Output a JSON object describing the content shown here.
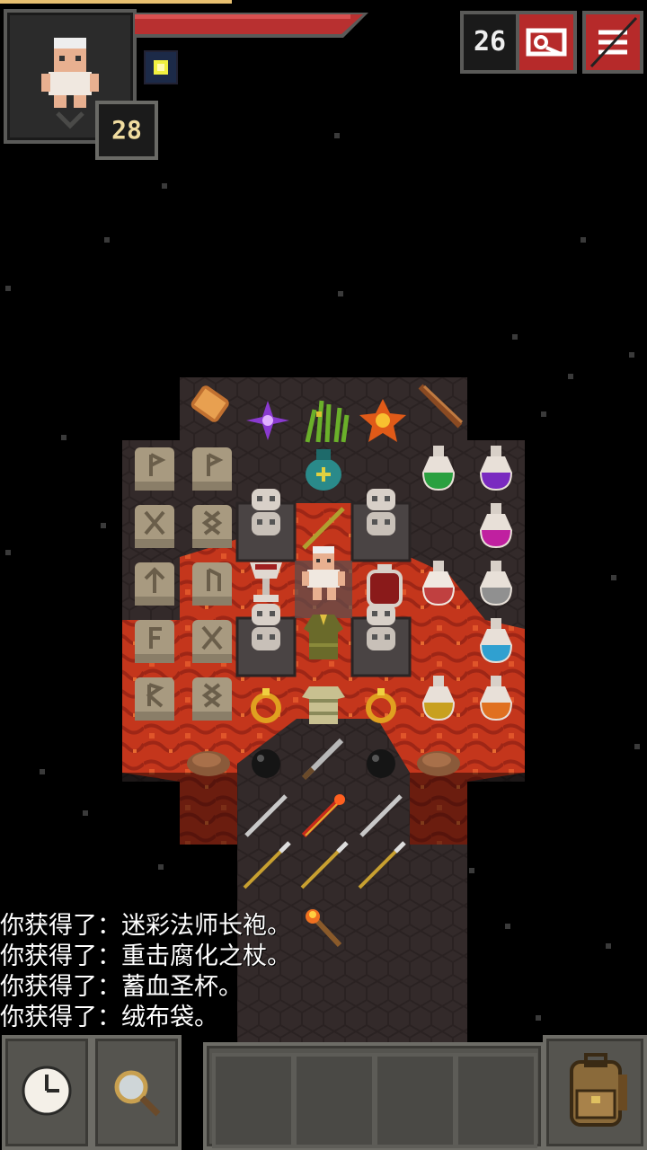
{
  "hud": {
    "hero_level": "28",
    "depth": "26",
    "journal_icon": "journal-icon",
    "menu_icon": "menu-icon"
  },
  "log": [
    "你获得了：迷彩法师长袍。",
    "你获得了：重击腐化之杖。",
    "你获得了：蓄血圣杯。",
    "你获得了：绒布袋。"
  ],
  "toolbar": {
    "wait_icon": "clock-icon",
    "search_icon": "magnifier-icon",
    "quickslots": [
      "",
      "",
      "",
      ""
    ],
    "backpack_icon": "backpack-icon"
  },
  "colors": {
    "lava": "#c8331a",
    "floor": "#3a3130",
    "hp": "#b83030",
    "button_red": "#b62a2a"
  }
}
